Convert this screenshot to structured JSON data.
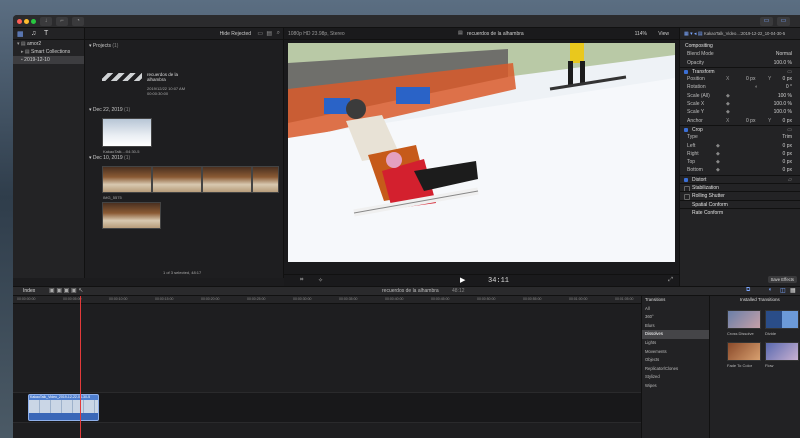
{
  "toolbar": {
    "library_name": "amor2"
  },
  "libraries": {
    "items": [
      {
        "label": "amor2",
        "selected": false
      },
      {
        "label": "Smart Collections",
        "selected": false
      },
      {
        "label": "2019-12-10",
        "selected": true
      }
    ]
  },
  "browser": {
    "filter": "Hide Rejected",
    "projects_header": "Projects",
    "projects_count": "(1)",
    "project": {
      "name": "recuerdos de la alhambra",
      "date": "2019/12/22 10:07 AM",
      "duration": "00:00:30:00"
    },
    "dates": [
      {
        "label": "Dec 22, 2019",
        "count": "(1)",
        "clip_label": "KakaoTalk...:04:30-5"
      },
      {
        "label": "Dec 10, 2019",
        "count": "(1)",
        "clip_label": "IMG_5575"
      }
    ],
    "status": "1 of 3 selected, 48:17"
  },
  "viewer": {
    "format": "1080p HD 23.98p, Stereo",
    "title": "recuerdos de la alhambra",
    "zoom": "114%",
    "view_label": "View",
    "timecode": "34:11"
  },
  "inspector": {
    "clip_title": "KakaoTalk_Video...:2019-12-22_10-04-30-5",
    "compositing_header": "Compositing",
    "blend_mode_label": "Blend Mode",
    "blend_mode_value": "Normal",
    "opacity_label": "Opacity",
    "opacity_value": "100.0 %",
    "transform_header": "Transform",
    "position_label": "Position",
    "position_x_label": "X",
    "position_x": "0 px",
    "position_y_label": "Y",
    "position_y": "0 px",
    "rotation_label": "Rotation",
    "rotation_value": "0 °",
    "scale_all_label": "Scale (All)",
    "scale_all_value": "100 %",
    "scale_x_label": "Scale X",
    "scale_x_value": "100.0 %",
    "scale_y_label": "Scale Y",
    "scale_y_value": "100.0 %",
    "anchor_label": "Anchor",
    "anchor_x_label": "X",
    "anchor_x": "0 px",
    "anchor_y_label": "Y",
    "anchor_y": "0 px",
    "crop_header": "Crop",
    "crop_type_label": "Type",
    "crop_type_value": "Trim",
    "left_label": "Left",
    "left_value": "0 px",
    "right_label": "Right",
    "right_value": "0 px",
    "top_label": "Top",
    "top_value": "0 px",
    "bottom_label": "Bottom",
    "bottom_value": "0 px",
    "distort_header": "Distort",
    "stabilization_label": "Stabilization",
    "rolling_shutter_label": "Rolling Shutter",
    "spatial_conform_label": "Spatial Conform",
    "rate_conform_label": "Rate Conform",
    "save_effects": "Save Effects"
  },
  "timeline": {
    "index_label": "Index",
    "project_title": "recuerdos de la alhambra",
    "duration": "48:12",
    "ruler_ticks": [
      "00:00:00:00",
      "00:00:05:00",
      "00:00:10:00",
      "00:00:15:00",
      "00:00:20:00",
      "00:00:25:00",
      "00:00:30:00",
      "00:00:35:00",
      "00:00:40:00",
      "00:00:45:00",
      "00:00:50:00",
      "00:00:55:00",
      "00:01:00:00",
      "00:01:05:00"
    ],
    "clip_name": "KakaoTalk_Video_2019-12-22-04-30-5"
  },
  "transitions": {
    "title": "Transitions",
    "installed": "Installed Transitions",
    "categories": [
      {
        "label": "All",
        "selected": false
      },
      {
        "label": "360°",
        "selected": false
      },
      {
        "label": "Blurs",
        "selected": false
      },
      {
        "label": "Dissolves",
        "selected": true
      },
      {
        "label": "Lights",
        "selected": false
      },
      {
        "label": "Movements",
        "selected": false
      },
      {
        "label": "Objects",
        "selected": false
      },
      {
        "label": "Replicator/Clones",
        "selected": false
      },
      {
        "label": "Stylized",
        "selected": false
      },
      {
        "label": "Wipes",
        "selected": false
      }
    ],
    "items": [
      {
        "label": "Cross Dissolve"
      },
      {
        "label": "Divide"
      },
      {
        "label": "Fade To Color"
      },
      {
        "label": "Flow"
      }
    ]
  }
}
